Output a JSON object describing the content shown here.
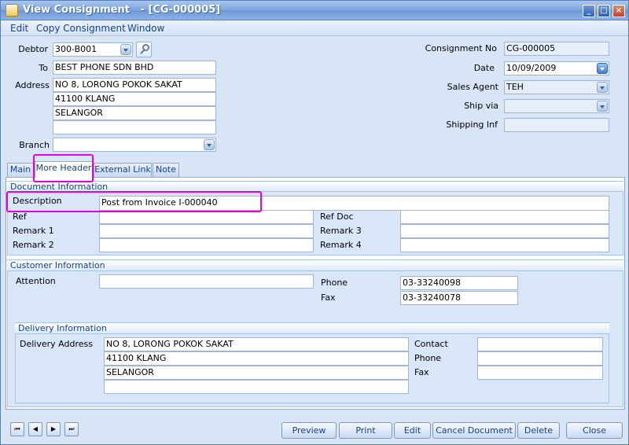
{
  "window": {
    "title": "View Consignment   - [CG-000005]",
    "controls": {
      "minimize": "_",
      "maximize": "□",
      "close": "×"
    }
  },
  "menu": [
    "Edit",
    "Copy Consignment",
    "Window"
  ],
  "header": {
    "debtor_label": "Debtor",
    "debtor": "300-B001",
    "to_label": "To",
    "to": "BEST PHONE SDN BHD",
    "address_label": "Address",
    "address": [
      "NO 8, LORONG POKOK SAKAT",
      "41100 KLANG",
      "SELANGOR",
      ""
    ],
    "branch_label": "Branch",
    "branch": "",
    "consignment_no_label": "Consignment No",
    "consignment_no": "CG-000005",
    "date_label": "Date",
    "date": "10/09/2009",
    "sales_agent_label": "Sales Agent",
    "sales_agent": "TEH",
    "ship_via_label": "Ship via",
    "ship_via": "",
    "shipping_inf_label": "Shipping Inf",
    "shipping_inf": ""
  },
  "tabs": [
    "Main",
    "More Header",
    "External Link",
    "Note"
  ],
  "active_tab": "More Header",
  "document_info": {
    "title": "Document Information",
    "description_label": "Description",
    "description": "Post from Invoice I-000040",
    "ref_label": "Ref",
    "ref": "",
    "ref_doc_label": "Ref Doc",
    "ref_doc": "",
    "remark1_label": "Remark 1",
    "remark1": "",
    "remark2_label": "Remark 2",
    "remark2": "",
    "remark3_label": "Remark 3",
    "remark3": "",
    "remark4_label": "Remark 4",
    "remark4": ""
  },
  "customer_info": {
    "title": "Customer Information",
    "attention_label": "Attention",
    "attention": "",
    "phone_label": "Phone",
    "phone": "03-33240098",
    "fax_label": "Fax",
    "fax": "03-33240078"
  },
  "delivery_info": {
    "title": "Delivery Information",
    "address_label": "Delivery Address",
    "address": [
      "NO 8, LORONG POKOK SAKAT",
      "41100 KLANG",
      "SELANGOR",
      ""
    ],
    "contact_label": "Contact",
    "contact": "",
    "phone_label": "Phone",
    "phone": "",
    "fax_label": "Fax",
    "fax": ""
  },
  "nav": {
    "first": "⏮",
    "prev": "◀",
    "next": "▶",
    "last": "⏭"
  },
  "buttons": {
    "preview": "Preview",
    "print": "Print",
    "edit": "Edit",
    "cancel_document": "Cancel Document",
    "delete": "Delete",
    "close": "Close"
  },
  "colors": {
    "highlight": "#e600e6",
    "accent": "#15428b",
    "panel": "#d7e5f7"
  }
}
